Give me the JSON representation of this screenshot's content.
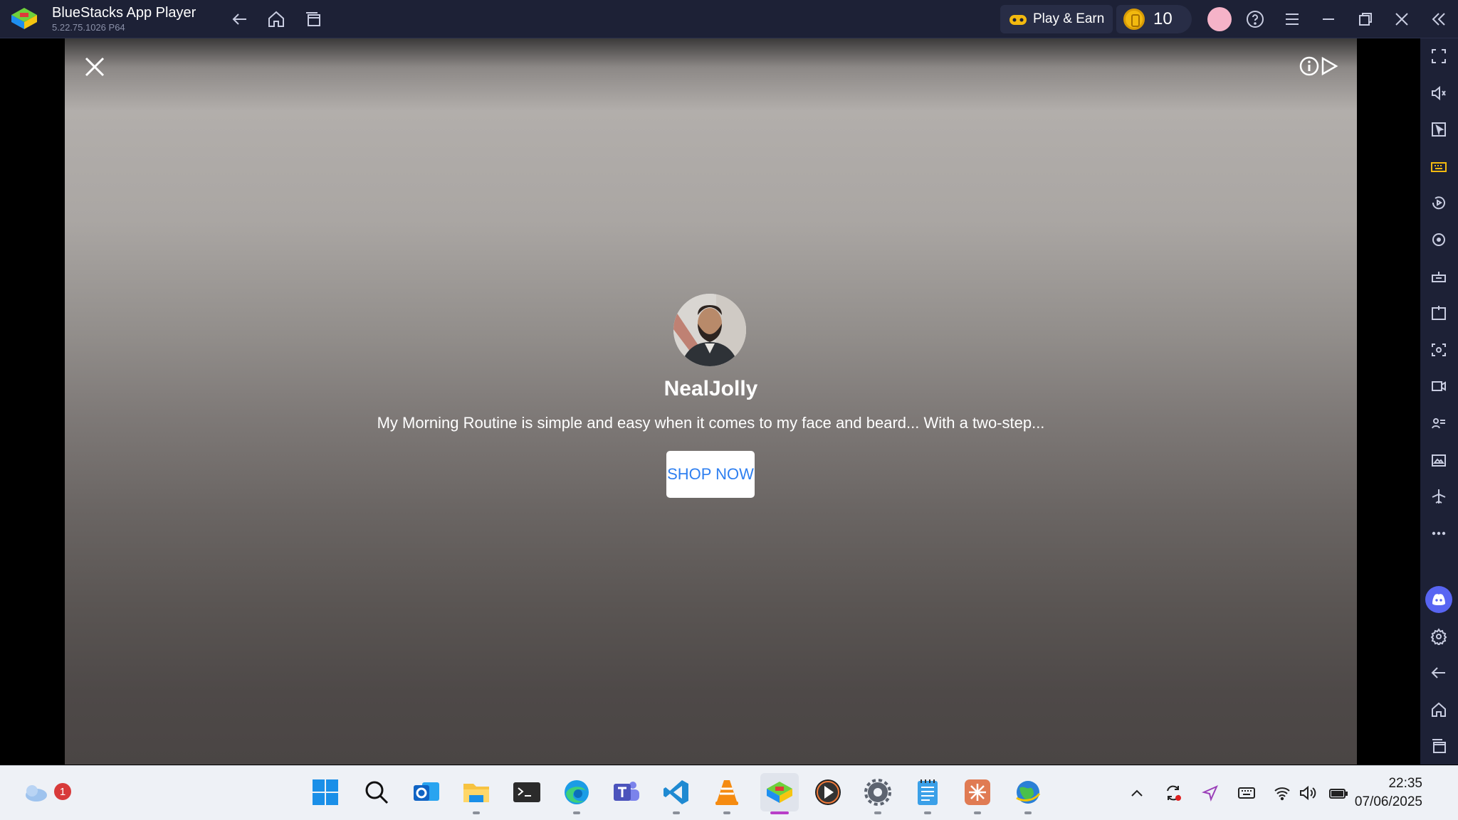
{
  "titlebar": {
    "app_name": "BlueStacks App Player",
    "version": "5.22.75.1026  P64",
    "play_earn_label": "Play & Earn",
    "coin_count": "10"
  },
  "ad": {
    "profile_name": "NealJolly",
    "description": "My Morning Routine is simple and easy when it comes to my face and beard... With a two-step...",
    "cta_label": "SHOP NOW"
  },
  "sidebar": {
    "icons": [
      "fullscreen-icon",
      "volume-icon",
      "cursor-icon",
      "keyboard-icon",
      "replay-icon",
      "rotate-icon",
      "robot-icon",
      "apk-icon",
      "screenshot-icon",
      "record-icon",
      "eco-icon",
      "media-folder-icon",
      "airplane-icon",
      "more-icon",
      "discord-icon",
      "settings-icon",
      "back-icon",
      "home-icon",
      "recents-icon"
    ]
  },
  "taskbar": {
    "weather_badge": "1",
    "time": "22:35",
    "date": "07/06/2025"
  }
}
